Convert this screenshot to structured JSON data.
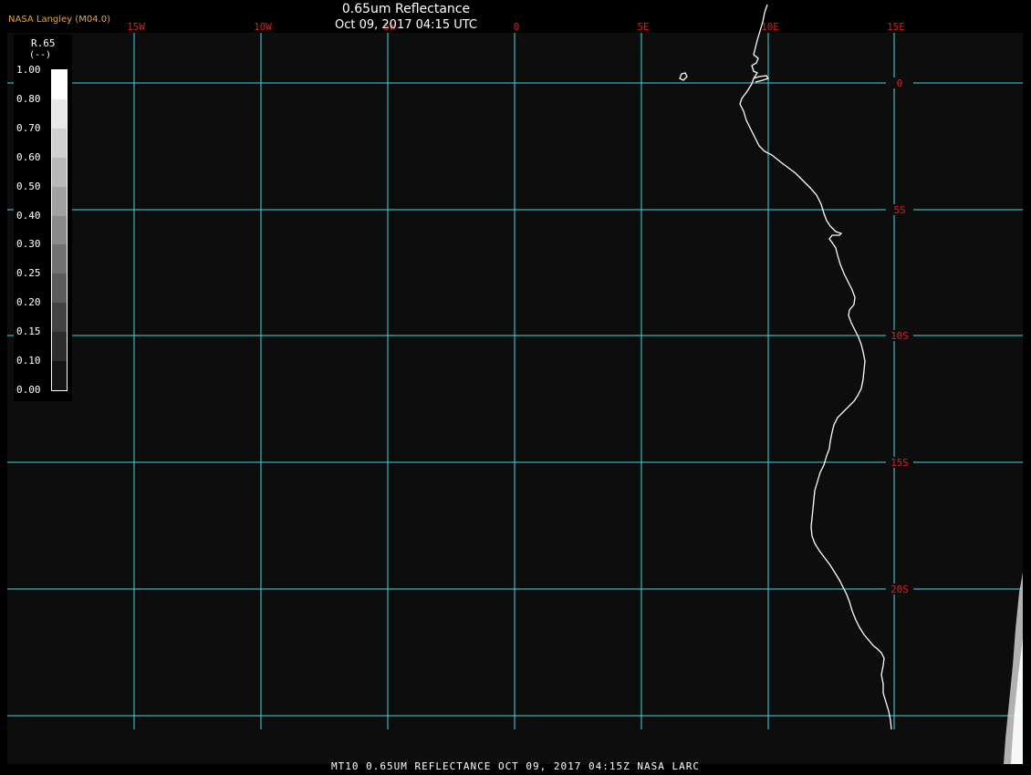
{
  "header": {
    "credit": "NASA Langley (M04.0)",
    "title": "0.65um Reflectance",
    "timestamp": "Oct 09, 2017 04:15 UTC"
  },
  "legend": {
    "variable": "R.65",
    "unit": "(--)",
    "ticks": [
      "1.00",
      "0.80",
      "0.70",
      "0.60",
      "0.50",
      "0.40",
      "0.30",
      "0.25",
      "0.20",
      "0.15",
      "0.10",
      "0.00"
    ]
  },
  "map": {
    "lon_labels": [
      "15W",
      "10W",
      "5W",
      "0",
      "5E",
      "10E",
      "15E"
    ],
    "lat_labels": [
      "0",
      "5S",
      "10S",
      "15S",
      "20S"
    ],
    "grid_color": "#3fd6e0",
    "label_color": "#d42020",
    "coast_color": "#ffffff",
    "background": "#0d0d0d"
  },
  "footer": {
    "text": "MT10  0.65UM REFLECTANCE   OCT 09, 2017 04:15Z   NASA LARC"
  }
}
